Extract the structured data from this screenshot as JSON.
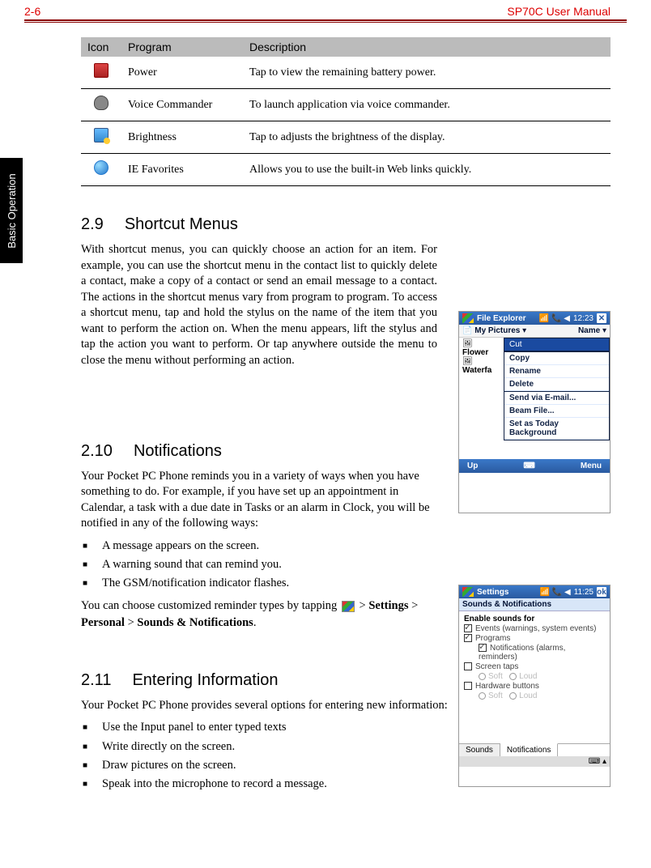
{
  "header": {
    "page": "2-6",
    "title": "SP70C User Manual"
  },
  "side_tab": "Basic Operation",
  "table": {
    "headers": {
      "icon": "Icon",
      "program": "Program",
      "description": "Description"
    },
    "rows": [
      {
        "program": "Power",
        "description": "Tap to view the remaining battery power."
      },
      {
        "program": "Voice Commander",
        "description": "To launch application via voice commander."
      },
      {
        "program": "Brightness",
        "description": "Tap to adjusts the brightness of the display."
      },
      {
        "program": " IE Favorites",
        "description": "Allows you to use the built-in Web links quickly."
      }
    ]
  },
  "s29": {
    "num": "2.9",
    "title": "Shortcut Menus",
    "body": "With shortcut menus, you can quickly choose an action for an item. For example, you can use the shortcut menu in the contact list to quickly delete a contact, make a copy of a contact or send an email message to a contact. The actions in the shortcut menus vary from program to program. To access a shortcut menu, tap and hold the stylus on the name of the item that you want to perform the action on. When the menu appears, lift the stylus and tap the action you want to perform. Or tap anywhere outside the menu to close the menu without performing an action."
  },
  "s210": {
    "num": "2.10",
    "title": "Notifications",
    "intro": "Your Pocket PC Phone reminds you in a variety of ways when you have something to do. For example, if you have set up an appointment in Calendar, a task with a due date in Tasks or an alarm in Clock, you will be notified in any of the following ways:",
    "bullets": [
      "A message appears on the screen.",
      "A warning sound that can remind you.",
      "The GSM/notification indicator flashes."
    ],
    "path_pre": "You can choose customized reminder types by tapping ",
    "path_post": " > ",
    "settings": "Settings",
    "personal": "Personal",
    "sounds": "Sounds & Notifications",
    "gt": " > ",
    "period": "."
  },
  "s211": {
    "num": "2.11",
    "title": "Entering Information",
    "intro": "Your Pocket PC Phone provides several options for entering new information:",
    "bullets": [
      "Use the Input panel to enter typed texts",
      "Write directly on the screen.",
      "Draw pictures on the screen.",
      "Speak into the microphone to record a message."
    ]
  },
  "shot1": {
    "title": "File Explorer",
    "time": "12:23",
    "row": "My Pictures",
    "row_right": "Name",
    "flower": "Flower",
    "waterfa": "Waterfa",
    "cut": "Cut",
    "menu": [
      "Copy",
      "Rename",
      "Delete",
      "Send via E-mail...",
      "Beam File...",
      "Set as Today Background"
    ],
    "up": "Up",
    "menu_btn": "Menu"
  },
  "shot2": {
    "title": "Settings",
    "time": "11:25",
    "ok": "ok",
    "sub": "Sounds & Notifications",
    "enable": "Enable sounds for",
    "opts": [
      {
        "checked": true,
        "label": "Events (warnings, system events)"
      },
      {
        "checked": true,
        "label": "Programs"
      },
      {
        "checked": true,
        "label": "Notifications (alarms, reminders)",
        "indent": true
      },
      {
        "checked": false,
        "label": "Screen taps"
      },
      {
        "checked": false,
        "label": "Hardware buttons"
      }
    ],
    "soft": "Soft",
    "loud": "Loud",
    "tab1": "Sounds",
    "tab2": "Notifications"
  }
}
